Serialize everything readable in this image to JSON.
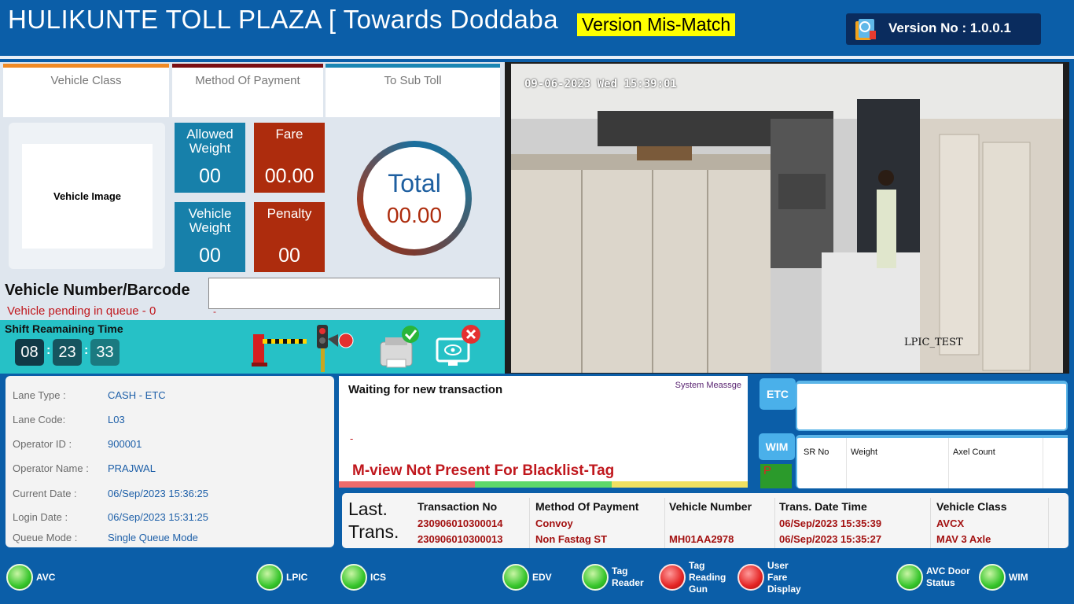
{
  "header": {
    "title": "HULIKUNTE TOLL PLAZA [  Towards Doddaba",
    "mismatch_badge": "Version Mis-Match",
    "version": "Version No : 1.0.0.1"
  },
  "tabs": [
    {
      "label": "Vehicle Class",
      "color": "#f08a24"
    },
    {
      "label": "Method Of Payment",
      "color": "#7a0f12"
    },
    {
      "label": "To Sub Toll",
      "color": "#1b86b3"
    }
  ],
  "vehicle_image_label": "Vehicle Image",
  "tiles": {
    "allowed_weight": {
      "label": "Allowed Weight",
      "value": "00"
    },
    "fare": {
      "label": "Fare",
      "value": "00.00"
    },
    "vehicle_weight": {
      "label": "Vehicle Weight",
      "value": "00"
    },
    "penalty": {
      "label": "Penalty",
      "value": "00"
    }
  },
  "total": {
    "label": "Total",
    "value": "00.00"
  },
  "vehicle_number": {
    "label": "Vehicle Number/Barcode",
    "value": ""
  },
  "queue_text": "Vehicle pending in queue - 0",
  "queue_dash": "-",
  "shift": {
    "label": "Shift Reamaining Time",
    "hh": "08",
    "mm": "23",
    "ss": "33",
    "sep": ":"
  },
  "camera": {
    "timestamp": "09-06-2023 Wed 15:39:01",
    "label": "LPIC_TEST"
  },
  "info": [
    {
      "key": "Lane Type :",
      "value": "CASH - ETC"
    },
    {
      "key": "Lane Code:",
      "value": "L03"
    },
    {
      "key": "Operator ID :",
      "value": "900001"
    },
    {
      "key": "Operator Name :",
      "value": "PRAJWAL"
    },
    {
      "key": "Current Date :",
      "value": "06/Sep/2023 15:36:25"
    },
    {
      "key": "Login Date :",
      "value": "06/Sep/2023 15:31:25"
    },
    {
      "key": "Queue Mode :",
      "value": "Single Queue Mode"
    }
  ],
  "messages": {
    "title": "Waiting for new transaction",
    "system_label": "System Meassge",
    "dash": "-",
    "alert": "M-view Not Present For Blacklist-Tag"
  },
  "etc": {
    "label": "ETC"
  },
  "wim": {
    "label": "WIM",
    "p_label": "P",
    "columns": [
      "SR No",
      "Weight",
      "Axel Count"
    ]
  },
  "last_trans": {
    "label_line1": "Last.",
    "label_line2": "Trans.",
    "columns": [
      "Transaction No",
      "Method Of Payment",
      "Vehicle Number",
      "Trans. Date Time",
      "Vehicle Class"
    ],
    "rows": [
      [
        "230906010300014",
        "Convoy",
        "",
        "06/Sep/2023 15:35:39",
        "AVCX"
      ],
      [
        "230906010300013",
        "Non Fastag ST",
        "MH01AA2978",
        "06/Sep/2023 15:35:27",
        "MAV 3 Axle"
      ]
    ]
  },
  "footer": {
    "items": [
      {
        "label": "AVC",
        "icon": "avc-icon",
        "state": "ok"
      },
      {
        "label": "LPIC",
        "icon": "lpic-camera-icon",
        "state": "ok"
      },
      {
        "label": "ICS",
        "icon": "ics-camera-icon",
        "state": "ok"
      },
      {
        "label": "EDV",
        "icon": "edv-icon",
        "state": "ok"
      },
      {
        "label": "Tag Reader",
        "icon": "tag-reader-icon",
        "state": "ok"
      },
      {
        "label": "Tag Reading Gun",
        "icon": "tag-reading-gun-icon",
        "state": "error"
      },
      {
        "label": "User Fare Display",
        "icon": "user-fare-display-icon",
        "state": "error"
      },
      {
        "label": "AVC Door Status",
        "icon": "avc-door-status-icon",
        "state": "ok"
      },
      {
        "label": "WIM",
        "icon": "wim-icon",
        "state": "ok"
      }
    ]
  },
  "colors": {
    "header_bg": "#0b5ea8",
    "shift_bg": "#26c1c6",
    "tile_blue": "#1780aa",
    "tile_red": "#ad2c0d",
    "alert_red": "#c0171d"
  }
}
